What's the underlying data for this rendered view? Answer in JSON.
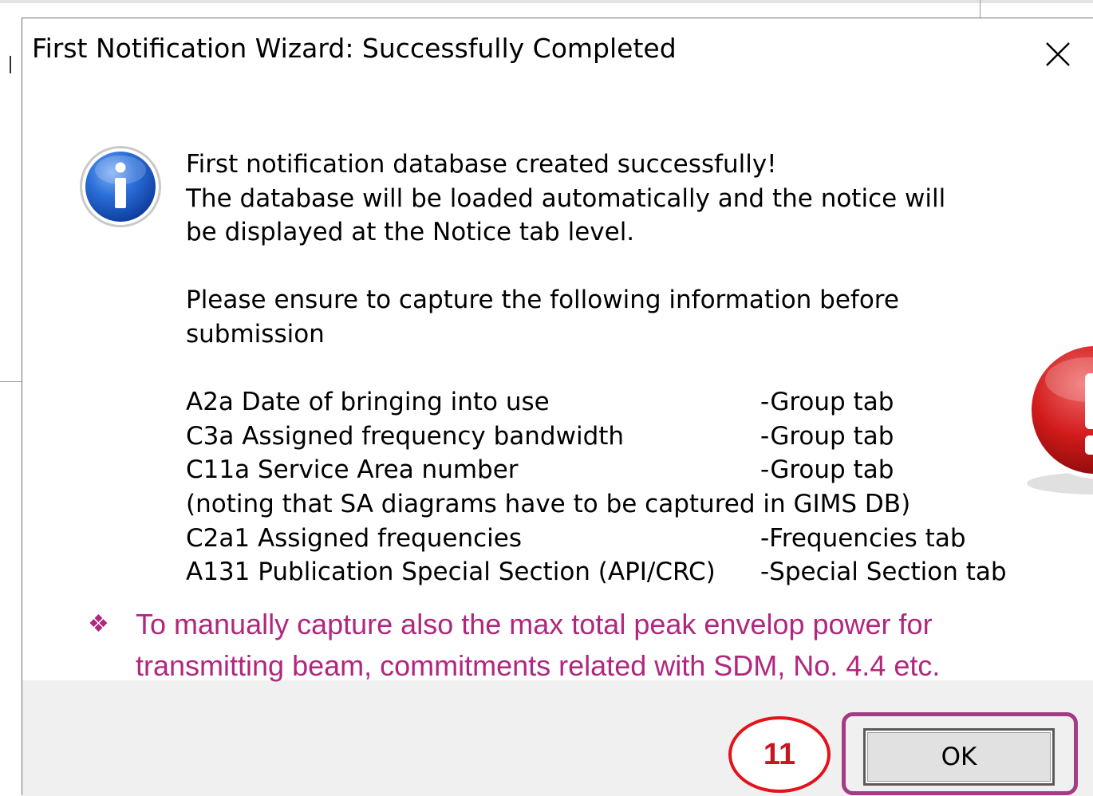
{
  "dialog": {
    "title": "First Notification Wizard: Successfully Completed",
    "close_icon": "close-icon"
  },
  "message": {
    "icon": "info-icon",
    "lines": [
      "First notification database created successfully!",
      "The database will be loaded automatically and the notice will",
      "be displayed at the Notice tab level."
    ],
    "ensure_lines": [
      "Please ensure to capture the following information before",
      "submission"
    ],
    "requirements": [
      {
        "code": "A2a  Date of bringing into use",
        "tab": "-Group tab"
      },
      {
        "code": "C3a  Assigned frequency bandwidth",
        "tab": "-Group tab"
      },
      {
        "code": "C11a Service Area number",
        "tab": "-Group tab"
      }
    ],
    "requirement_note": "(noting that SA diagrams have to be captured in GIMS DB)",
    "requirements_2": [
      {
        "code": "C2a1 Assigned frequencies",
        "tab": "-Frequencies tab"
      },
      {
        "code": "A131 Publication Special Section (API/CRC)",
        "tab": "-Special Section tab"
      }
    ]
  },
  "annotation": {
    "bullet": "❖",
    "lines": [
      "To manually capture also the max total peak envelop power for",
      "transmitting beam, commitments related with SDM, No. 4.4 etc."
    ],
    "color": "#b0277e",
    "step_number": "11",
    "step_color": "#e3121b",
    "frame_color": "#a53a85"
  },
  "footer": {
    "ok_label": "OK"
  },
  "side_icon": "warning-icon"
}
